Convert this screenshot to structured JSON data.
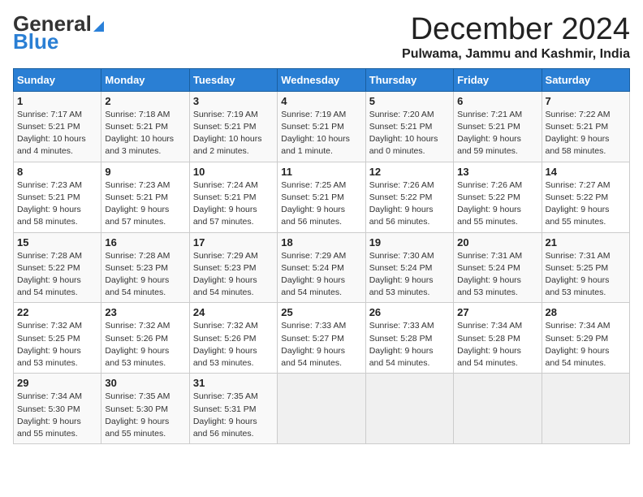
{
  "header": {
    "logo_line1": "General",
    "logo_line2": "Blue",
    "month": "December 2024",
    "location": "Pulwama, Jammu and Kashmir, India"
  },
  "weekdays": [
    "Sunday",
    "Monday",
    "Tuesday",
    "Wednesday",
    "Thursday",
    "Friday",
    "Saturday"
  ],
  "weeks": [
    [
      {
        "day": "1",
        "info": "Sunrise: 7:17 AM\nSunset: 5:21 PM\nDaylight: 10 hours\nand 4 minutes."
      },
      {
        "day": "2",
        "info": "Sunrise: 7:18 AM\nSunset: 5:21 PM\nDaylight: 10 hours\nand 3 minutes."
      },
      {
        "day": "3",
        "info": "Sunrise: 7:19 AM\nSunset: 5:21 PM\nDaylight: 10 hours\nand 2 minutes."
      },
      {
        "day": "4",
        "info": "Sunrise: 7:19 AM\nSunset: 5:21 PM\nDaylight: 10 hours\nand 1 minute."
      },
      {
        "day": "5",
        "info": "Sunrise: 7:20 AM\nSunset: 5:21 PM\nDaylight: 10 hours\nand 0 minutes."
      },
      {
        "day": "6",
        "info": "Sunrise: 7:21 AM\nSunset: 5:21 PM\nDaylight: 9 hours\nand 59 minutes."
      },
      {
        "day": "7",
        "info": "Sunrise: 7:22 AM\nSunset: 5:21 PM\nDaylight: 9 hours\nand 58 minutes."
      }
    ],
    [
      {
        "day": "8",
        "info": "Sunrise: 7:23 AM\nSunset: 5:21 PM\nDaylight: 9 hours\nand 58 minutes."
      },
      {
        "day": "9",
        "info": "Sunrise: 7:23 AM\nSunset: 5:21 PM\nDaylight: 9 hours\nand 57 minutes."
      },
      {
        "day": "10",
        "info": "Sunrise: 7:24 AM\nSunset: 5:21 PM\nDaylight: 9 hours\nand 57 minutes."
      },
      {
        "day": "11",
        "info": "Sunrise: 7:25 AM\nSunset: 5:21 PM\nDaylight: 9 hours\nand 56 minutes."
      },
      {
        "day": "12",
        "info": "Sunrise: 7:26 AM\nSunset: 5:22 PM\nDaylight: 9 hours\nand 56 minutes."
      },
      {
        "day": "13",
        "info": "Sunrise: 7:26 AM\nSunset: 5:22 PM\nDaylight: 9 hours\nand 55 minutes."
      },
      {
        "day": "14",
        "info": "Sunrise: 7:27 AM\nSunset: 5:22 PM\nDaylight: 9 hours\nand 55 minutes."
      }
    ],
    [
      {
        "day": "15",
        "info": "Sunrise: 7:28 AM\nSunset: 5:22 PM\nDaylight: 9 hours\nand 54 minutes."
      },
      {
        "day": "16",
        "info": "Sunrise: 7:28 AM\nSunset: 5:23 PM\nDaylight: 9 hours\nand 54 minutes."
      },
      {
        "day": "17",
        "info": "Sunrise: 7:29 AM\nSunset: 5:23 PM\nDaylight: 9 hours\nand 54 minutes."
      },
      {
        "day": "18",
        "info": "Sunrise: 7:29 AM\nSunset: 5:24 PM\nDaylight: 9 hours\nand 54 minutes."
      },
      {
        "day": "19",
        "info": "Sunrise: 7:30 AM\nSunset: 5:24 PM\nDaylight: 9 hours\nand 53 minutes."
      },
      {
        "day": "20",
        "info": "Sunrise: 7:31 AM\nSunset: 5:24 PM\nDaylight: 9 hours\nand 53 minutes."
      },
      {
        "day": "21",
        "info": "Sunrise: 7:31 AM\nSunset: 5:25 PM\nDaylight: 9 hours\nand 53 minutes."
      }
    ],
    [
      {
        "day": "22",
        "info": "Sunrise: 7:32 AM\nSunset: 5:25 PM\nDaylight: 9 hours\nand 53 minutes."
      },
      {
        "day": "23",
        "info": "Sunrise: 7:32 AM\nSunset: 5:26 PM\nDaylight: 9 hours\nand 53 minutes."
      },
      {
        "day": "24",
        "info": "Sunrise: 7:32 AM\nSunset: 5:26 PM\nDaylight: 9 hours\nand 53 minutes."
      },
      {
        "day": "25",
        "info": "Sunrise: 7:33 AM\nSunset: 5:27 PM\nDaylight: 9 hours\nand 54 minutes."
      },
      {
        "day": "26",
        "info": "Sunrise: 7:33 AM\nSunset: 5:28 PM\nDaylight: 9 hours\nand 54 minutes."
      },
      {
        "day": "27",
        "info": "Sunrise: 7:34 AM\nSunset: 5:28 PM\nDaylight: 9 hours\nand 54 minutes."
      },
      {
        "day": "28",
        "info": "Sunrise: 7:34 AM\nSunset: 5:29 PM\nDaylight: 9 hours\nand 54 minutes."
      }
    ],
    [
      {
        "day": "29",
        "info": "Sunrise: 7:34 AM\nSunset: 5:30 PM\nDaylight: 9 hours\nand 55 minutes."
      },
      {
        "day": "30",
        "info": "Sunrise: 7:35 AM\nSunset: 5:30 PM\nDaylight: 9 hours\nand 55 minutes."
      },
      {
        "day": "31",
        "info": "Sunrise: 7:35 AM\nSunset: 5:31 PM\nDaylight: 9 hours\nand 56 minutes."
      },
      null,
      null,
      null,
      null
    ]
  ]
}
